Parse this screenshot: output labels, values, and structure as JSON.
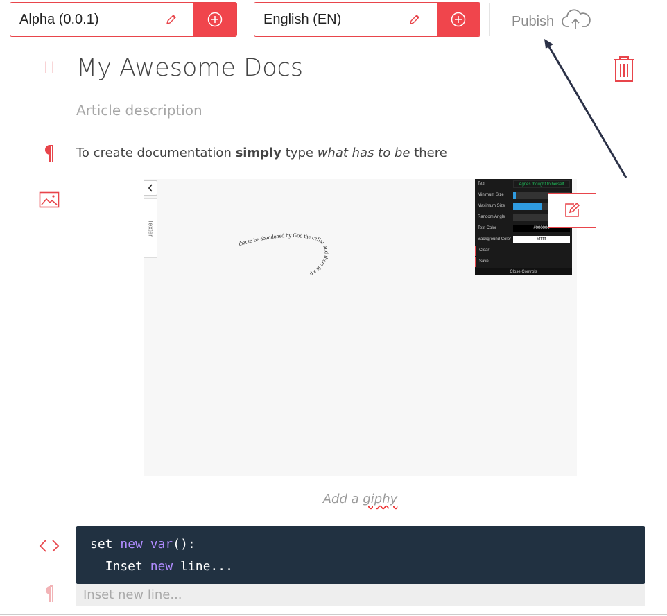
{
  "toolbar": {
    "version_label": "Alpha (0.0.1)",
    "language_label": "English (EN)",
    "publish_label": "Pubish"
  },
  "article": {
    "heading_marker": "H",
    "title": "My Awesome Docs",
    "description": "Article description",
    "paragraph": {
      "before": "To create documentation ",
      "bold": "simply",
      "middle": " type ",
      "italic": "what has to be",
      "after": " there"
    }
  },
  "image_block": {
    "side_tab_label": "Texter",
    "curvy_text": "that to be abandoned by God the cellar and there is a p",
    "controls": {
      "rows": [
        {
          "label": "Text",
          "value": "Agnes thought to herself"
        },
        {
          "label": "Minimum Size",
          "fill": 0.05
        },
        {
          "label": "Maximum Size",
          "fill": 0.5
        },
        {
          "label": "Random Angle",
          "fill": 0
        },
        {
          "label": "Text Color",
          "value": "#000000"
        },
        {
          "label": "Background Color",
          "value": "#ffffff"
        },
        {
          "label": "Clear"
        },
        {
          "label": "Save"
        }
      ],
      "close_label": "Close Controls"
    },
    "caption_prefix": "Add a ",
    "caption_word": "giphy"
  },
  "code_block": {
    "line1": {
      "a": "set ",
      "kw1": "new",
      "b": " ",
      "kw2": "var",
      "c": "():"
    },
    "line2": {
      "a": "  Inset ",
      "kw": "new",
      "b": " line..."
    }
  },
  "new_line_placeholder": "Inset new line...",
  "colors": {
    "accent": "#f0454c",
    "code_bg": "#213141",
    "keyword": "#b08cff"
  },
  "icons": [
    "pencil-icon",
    "plus-circle-icon",
    "cloud-upload-icon",
    "trash-icon",
    "paragraph-icon",
    "image-icon",
    "code-icon",
    "edit-icon",
    "chevron-left-icon"
  ]
}
